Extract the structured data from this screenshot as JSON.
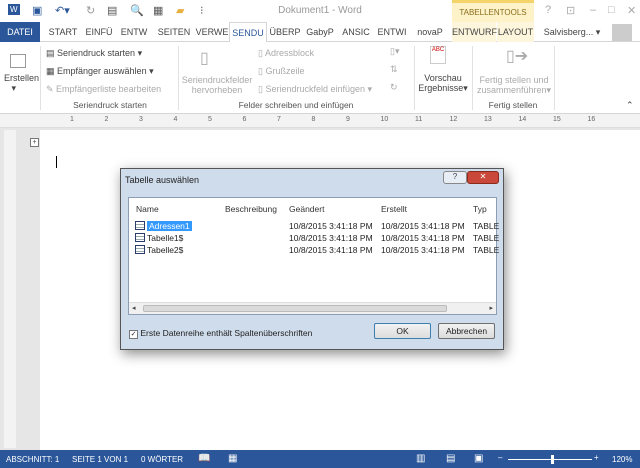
{
  "title": "Dokument1 - Word",
  "context_tab": "TABELLENTOOLS",
  "tabs": [
    "DATEI",
    "START",
    "EINFÜ",
    "ENTW",
    "SEITEN",
    "VERWE",
    "SENDU",
    "ÜBERP",
    "GabyP",
    "ANSIC",
    "ENTWI",
    "novaP",
    "ENTWURF",
    "LAYOUT"
  ],
  "user": "Salvisberg...",
  "ribbon": {
    "erstellen": "Erstellen",
    "seriendruck_starten": "Seriendruck starten",
    "empfaenger_auswaehlen": "Empfänger auswählen",
    "empfaengerliste": "Empfängerliste bearbeiten",
    "felder_hervorheben_1": "Seriendruckfelder",
    "felder_hervorheben_2": "hervorheben",
    "adressblock": "Adressblock",
    "grusszeile": "Grußzeile",
    "feld_einfuegen": "Seriendruckfeld einfügen",
    "vorschau_1": "Vorschau",
    "vorschau_2": "Ergebnisse",
    "fertig_1": "Fertig stellen und",
    "fertig_2": "zusammenführen",
    "groups": [
      "Seriendruck starten",
      "Felder schreiben und einfügen",
      "Fertig stellen"
    ]
  },
  "ruler_numbers": [
    "1",
    "2",
    "3",
    "4",
    "5",
    "6",
    "7",
    "8",
    "9",
    "10",
    "11",
    "12",
    "13",
    "14",
    "15",
    "16"
  ],
  "dialog": {
    "title": "Tabelle auswählen",
    "columns": [
      "Name",
      "Beschreibung",
      "Geändert",
      "Erstellt",
      "Typ"
    ],
    "rows": [
      {
        "name": "Adressen1",
        "desc": "",
        "changed": "10/8/2015 3:41:18 PM",
        "created": "10/8/2015 3:41:18 PM",
        "type": "TABLE",
        "selected": true
      },
      {
        "name": "Tabelle1$",
        "desc": "",
        "changed": "10/8/2015 3:41:18 PM",
        "created": "10/8/2015 3:41:18 PM",
        "type": "TABLE",
        "selected": false
      },
      {
        "name": "Tabelle2$",
        "desc": "",
        "changed": "10/8/2015 3:41:18 PM",
        "created": "10/8/2015 3:41:18 PM",
        "type": "TABLE",
        "selected": false
      }
    ],
    "checkbox_label": "Erste Datenreihe enthält Spaltenüberschriften",
    "checkbox_checked": true,
    "ok": "OK",
    "cancel": "Abbrechen"
  },
  "status": {
    "section": "ABSCHNITT: 1",
    "page": "SEITE 1 VON 1",
    "words": "0 WÖRTER",
    "zoom": "120%",
    "zoom_level_percent": 120
  }
}
